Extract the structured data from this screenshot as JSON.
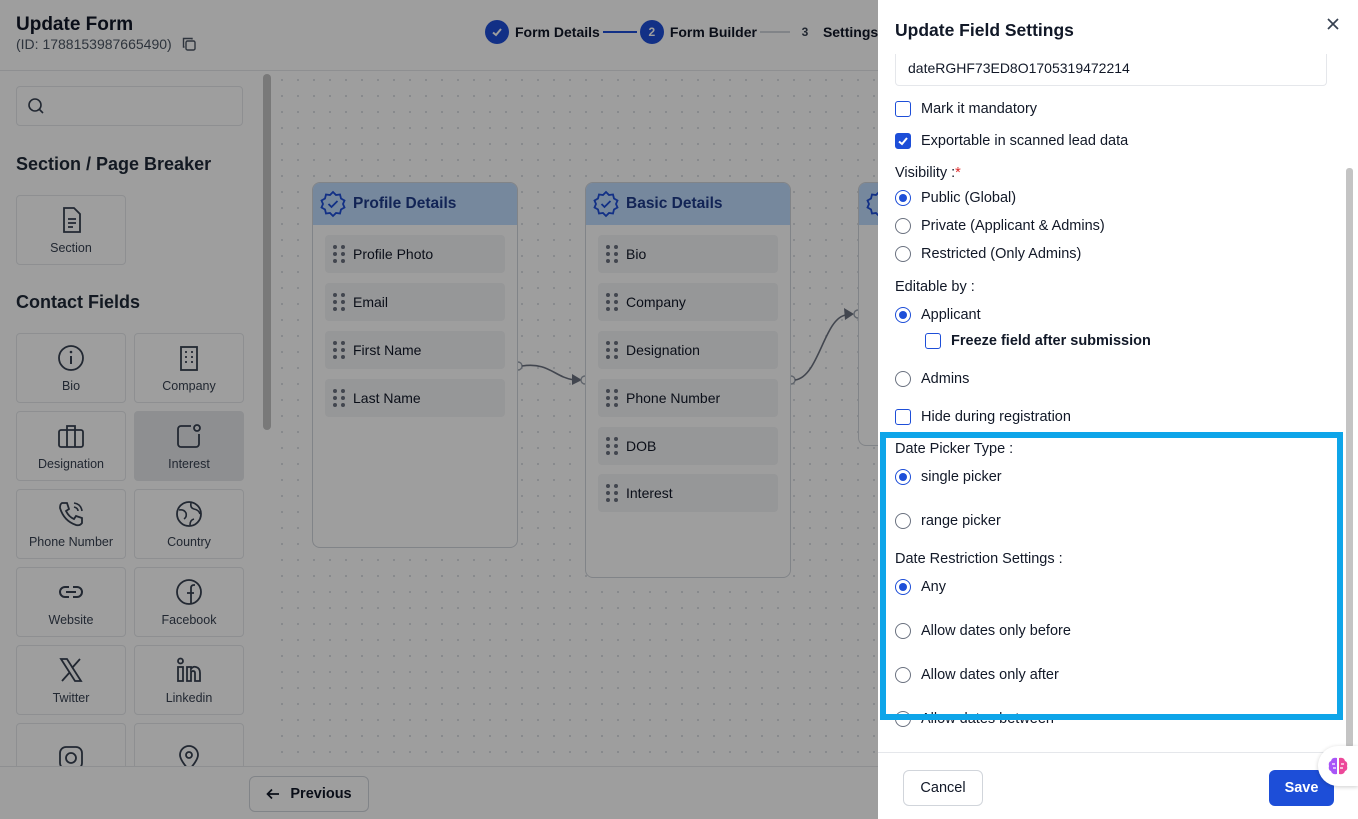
{
  "header": {
    "title": "Update Form",
    "id_text": "(ID: 1788153987665490)",
    "steps": [
      {
        "num": "1",
        "label": "Form Details"
      },
      {
        "num": "2",
        "label": "Form Builder"
      },
      {
        "num": "3",
        "label": "Settings"
      }
    ]
  },
  "sidebar": {
    "search_placeholder": "",
    "section_heading": "Section / Page Breaker",
    "section_tile": "Section",
    "contact_heading": "Contact Fields",
    "tiles": [
      "Bio",
      "Company",
      "Designation",
      "Interest",
      "Phone Number",
      "Country",
      "Website",
      "Facebook",
      "Twitter",
      "Linkedin"
    ]
  },
  "canvas": {
    "cards": [
      {
        "title": "Profile Details",
        "items": [
          "Profile Photo",
          "Email",
          "First Name",
          "Last Name"
        ]
      },
      {
        "title": "Basic Details",
        "items": [
          "Bio",
          "Company",
          "Designation",
          "Phone Number",
          "DOB",
          "Interest"
        ]
      }
    ]
  },
  "bottom": {
    "previous_label": "Previous"
  },
  "drawer": {
    "title": "Update Field Settings",
    "field_name_value": "dateRGHF73ED8O1705319472214",
    "mandatory_label": "Mark it mandatory",
    "exportable_label": "Exportable in scanned lead data",
    "visibility_label": "Visibility :",
    "required_mark": "*",
    "visibility_options": [
      "Public (Global)",
      "Private (Applicant & Admins)",
      "Restricted (Only Admins)"
    ],
    "editable_label": "Editable by :",
    "editable_applicant": "Applicant",
    "freeze_label": "Freeze field after submission",
    "editable_admins": "Admins",
    "hide_label": "Hide during registration",
    "picker_type_label": "Date Picker Type :",
    "picker_options": [
      "single picker",
      "range picker"
    ],
    "restriction_label": "Date Restriction Settings :",
    "restriction_options": [
      "Any",
      "Allow dates only before",
      "Allow dates only after",
      "Allow dates between"
    ],
    "cancel_label": "Cancel",
    "save_label": "Save"
  },
  "colors": {
    "primary": "#1d4ed8",
    "highlight": "#0ea5e9",
    "card_header": "#bfdbfe"
  }
}
